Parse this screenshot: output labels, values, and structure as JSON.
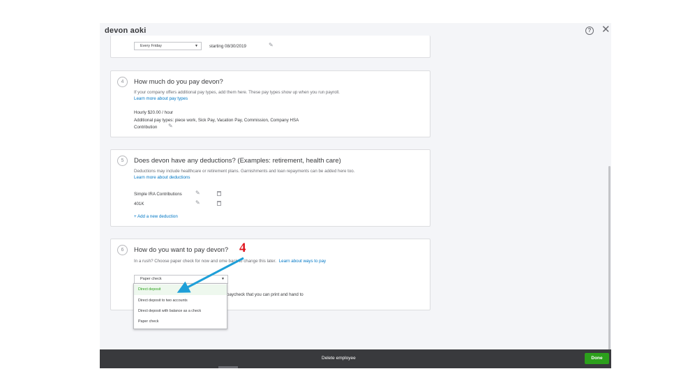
{
  "header": {
    "employee_name": "devon aoki",
    "help_icon": "help-circle-icon",
    "close_icon": "close-icon",
    "help_glyph": "?",
    "close_glyph": "✕"
  },
  "schedule": {
    "frequency_value": "Every Friday",
    "starting_text": "starting 08/30/2019"
  },
  "pay": {
    "step": "4",
    "title": "How much do you pay devon?",
    "description": "If your company offers additional pay types, add them here. These pay types show up when you run payroll.",
    "learn_link": "Learn more about pay types",
    "hourly": "Hourly $20.00 / hour",
    "additional_line1": "Additional pay types: piece work, Sick Pay, Vacation Pay, Commission, Company HSA",
    "additional_line2": "Contribution"
  },
  "deductions": {
    "step": "5",
    "title": "Does devon have any deductions? (Examples: retirement, health care)",
    "description": "Deductions may include healthcare or retirement plans. Garnishments and loan repayments can be added here too.",
    "learn_link": "Learn more about deductions",
    "items": [
      {
        "label": "Simple IRA Contributions"
      },
      {
        "label": "401K"
      }
    ],
    "add_link": "+ Add a new deduction"
  },
  "payment_method": {
    "step": "6",
    "title": "How do you want to pay devon?",
    "description_before": "In a rush? Choose paper check for now and",
    "description_after": "ome back to change this later.",
    "learn_link": "Learn about ways to pay",
    "selected_value": "Paper check",
    "partial_text": "paycheck that you can print and hand to",
    "options": [
      {
        "label": "Direct deposit"
      },
      {
        "label": "Direct deposit to two accounts"
      },
      {
        "label": "Direct deposit with balance as a check"
      },
      {
        "label": "Paper check"
      }
    ]
  },
  "footer": {
    "delete_label": "Delete employee",
    "done_label": "Done"
  },
  "annotation": {
    "step_number": "4",
    "color": "#e0131c",
    "arrow_color": "#1e9fd8"
  },
  "colors": {
    "accent_green": "#2ca01c",
    "link_blue": "#0077c5",
    "footer_bg": "#393a3d"
  }
}
